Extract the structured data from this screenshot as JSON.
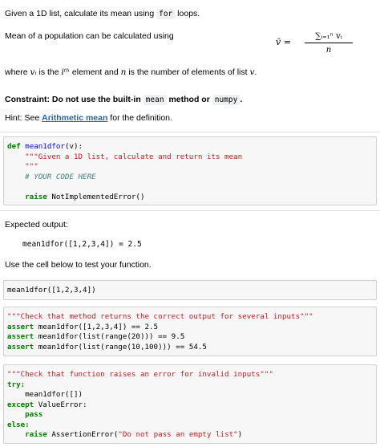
{
  "intro": {
    "line1_a": "Given a 1D list, calculate its mean using ",
    "line1_code": "for",
    "line1_b": " loops.",
    "line2": "Mean of a population can be calculated using",
    "formula_lhs": "v̄ =",
    "formula_num": "∑ᵢ₌₁ⁿ vᵢ",
    "formula_den": "n",
    "where_a": "where ",
    "where_vi": "vᵢ",
    "where_b": " is the ",
    "where_ith": "iᵗʰ",
    "where_c": " element and ",
    "where_n": "n",
    "where_d": " is the number of elements of list ",
    "where_v": "v",
    "where_e": ".",
    "constraint_a": "Constraint: Do not use the built-in ",
    "constraint_code1": "mean",
    "constraint_b": " method or ",
    "constraint_code2": "numpy",
    "constraint_c": ".",
    "hint_a": "Hint: See ",
    "hint_link": "Arithmetic mean",
    "hint_b": " for the definition."
  },
  "cell1": {
    "l1_kw": "def",
    "l1_fn": "mean1dfor",
    "l1_rest": "(v):",
    "l2": "    \"\"\"Given a 1D list, calculate and return its mean",
    "l3": "    \"\"\"",
    "l4": "    # YOUR CODE HERE",
    "l5_kw": "    raise",
    "l5_rest": " NotImplementedError()"
  },
  "expected": {
    "label": "Expected output:",
    "code": "mean1dfor([1,2,3,4]) = 2.5",
    "test_label": "Use the cell below to test your function."
  },
  "cell2": {
    "code": "mean1dfor([1,2,3,4])"
  },
  "cell3": {
    "l1": "\"\"\"Check that method returns the correct output for several inputs\"\"\"",
    "l2_kw": "assert",
    "l2_rest": " mean1dfor([1,2,3,4]) == 2.5",
    "l3_kw": "assert",
    "l3_rest": " mean1dfor(list(range(20))) == 9.5",
    "l4_kw": "assert",
    "l4_rest": " mean1dfor(list(range(10,100))) == 54.5"
  },
  "cell4": {
    "l1": "\"\"\"Check that function raises an error for invalid inputs\"\"\"",
    "l2_kw": "try:",
    "l3": "    mean1dfor([])",
    "l4_kw": "except",
    "l4_rest": " ValueError:",
    "l5_kw": "    pass",
    "l6_kw": "else:",
    "l7_kw": "    raise",
    "l7_rest": " AssertionError(",
    "l7_str": "\"Do not pass an empty list\"",
    "l7_end": ")"
  }
}
